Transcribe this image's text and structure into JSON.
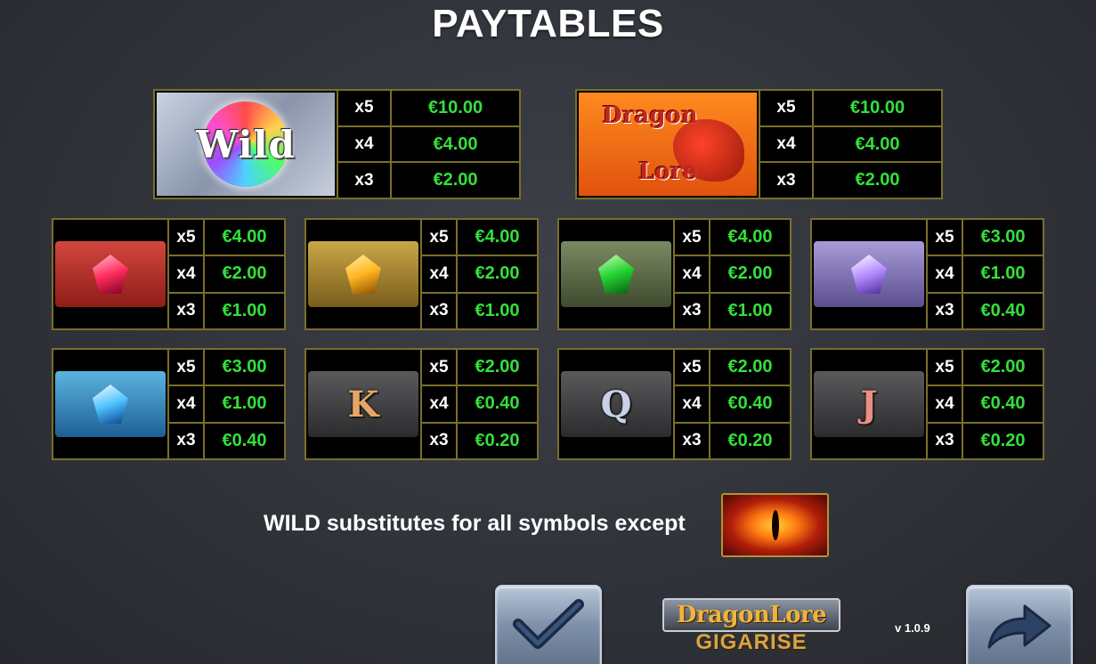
{
  "title": "PAYTABLES",
  "colors": {
    "amount": "#33e03a",
    "border": "#7a6f2a",
    "background": "#2f3238"
  },
  "big_symbols": [
    {
      "symbol": "Wild",
      "label": "Wild",
      "rows": [
        {
          "mult": "x5",
          "amt": "€10.00"
        },
        {
          "mult": "x4",
          "amt": "€4.00"
        },
        {
          "mult": "x3",
          "amt": "€2.00"
        }
      ]
    },
    {
      "symbol": "Dragon Lore",
      "label_top": "Dragon",
      "label_bottom": "Lore",
      "rows": [
        {
          "mult": "x5",
          "amt": "€10.00"
        },
        {
          "mult": "x4",
          "amt": "€4.00"
        },
        {
          "mult": "x3",
          "amt": "€2.00"
        }
      ]
    }
  ],
  "small_symbols": [
    {
      "symbol": "red-gem-icon",
      "rows": [
        {
          "mult": "x5",
          "amt": "€4.00"
        },
        {
          "mult": "x4",
          "amt": "€2.00"
        },
        {
          "mult": "x3",
          "amt": "€1.00"
        }
      ]
    },
    {
      "symbol": "yellow-gem-icon",
      "rows": [
        {
          "mult": "x5",
          "amt": "€4.00"
        },
        {
          "mult": "x4",
          "amt": "€2.00"
        },
        {
          "mult": "x3",
          "amt": "€1.00"
        }
      ]
    },
    {
      "symbol": "green-gem-icon",
      "rows": [
        {
          "mult": "x5",
          "amt": "€4.00"
        },
        {
          "mult": "x4",
          "amt": "€2.00"
        },
        {
          "mult": "x3",
          "amt": "€1.00"
        }
      ]
    },
    {
      "symbol": "purple-gem-icon",
      "rows": [
        {
          "mult": "x5",
          "amt": "€3.00"
        },
        {
          "mult": "x4",
          "amt": "€1.00"
        },
        {
          "mult": "x3",
          "amt": "€0.40"
        }
      ]
    },
    {
      "symbol": "blue-gem-icon",
      "rows": [
        {
          "mult": "x5",
          "amt": "€3.00"
        },
        {
          "mult": "x4",
          "amt": "€1.00"
        },
        {
          "mult": "x3",
          "amt": "€0.40"
        }
      ]
    },
    {
      "symbol": "K",
      "letter": "K",
      "rows": [
        {
          "mult": "x5",
          "amt": "€2.00"
        },
        {
          "mult": "x4",
          "amt": "€0.40"
        },
        {
          "mult": "x3",
          "amt": "€0.20"
        }
      ]
    },
    {
      "symbol": "Q",
      "letter": "Q",
      "rows": [
        {
          "mult": "x5",
          "amt": "€2.00"
        },
        {
          "mult": "x4",
          "amt": "€0.40"
        },
        {
          "mult": "x3",
          "amt": "€0.20"
        }
      ]
    },
    {
      "symbol": "J",
      "letter": "J",
      "rows": [
        {
          "mult": "x5",
          "amt": "€2.00"
        },
        {
          "mult": "x4",
          "amt": "€0.40"
        },
        {
          "mult": "x3",
          "amt": "€0.20"
        }
      ]
    }
  ],
  "note": "WILD substitutes for all symbols except",
  "scatter_icon": "dragon-eye-icon",
  "logo": {
    "top": "DragonLore",
    "bottom": "GIGARISE"
  },
  "version": "v 1.0.9",
  "buttons": {
    "confirm_icon": "checkmark-icon",
    "next_icon": "arrow-right-icon"
  }
}
